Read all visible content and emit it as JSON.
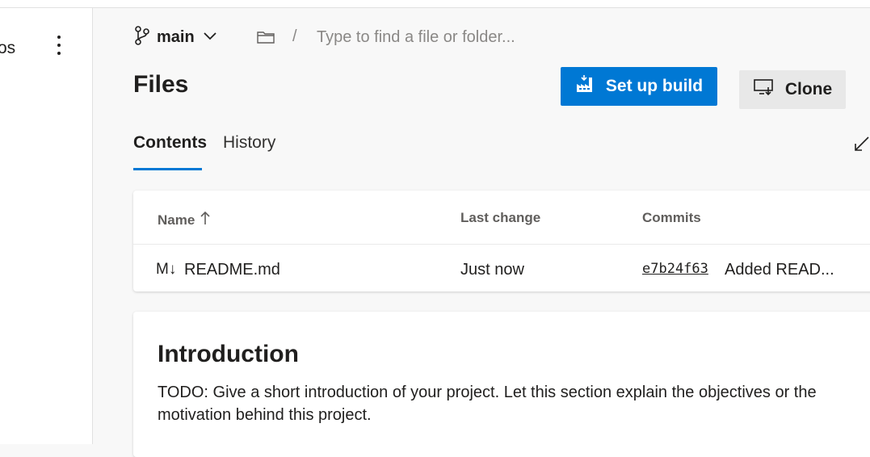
{
  "sidebar": {
    "partial_label": "os",
    "more_icon": "more-vertical-icon"
  },
  "branch": {
    "name": "main",
    "icon": "branch-icon"
  },
  "path": {
    "separator": "/",
    "placeholder": "Type to find a file or folder..."
  },
  "page": {
    "title": "Files"
  },
  "actions": {
    "setup_build_label": "Set up build",
    "clone_label": "Clone"
  },
  "tabs": [
    {
      "label": "Contents",
      "active": true
    },
    {
      "label": "History",
      "active": false
    }
  ],
  "table": {
    "columns": [
      "Name",
      "Last change",
      "Commits"
    ],
    "sort_icon": "arrow-up-icon",
    "rows": [
      {
        "icon_text": "M↓",
        "name": "README.md",
        "last_change": "Just now",
        "commit_id": "e7b24f63",
        "commit_message": "Added READ..."
      }
    ]
  },
  "readme": {
    "heading": "Introduction",
    "body": "TODO: Give a short introduction of your project. Let this section explain the objectives or the motivation behind this project."
  },
  "colors": {
    "accent": "#0078d4",
    "background": "#f8f8f8"
  }
}
